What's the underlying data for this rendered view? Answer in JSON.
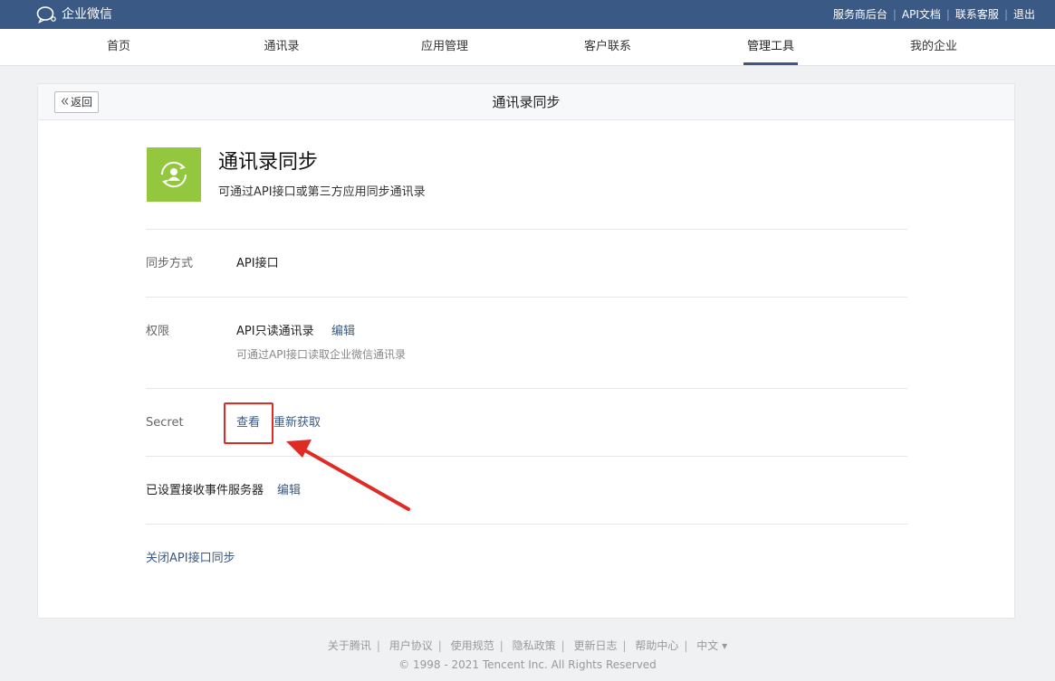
{
  "brand": {
    "name": "企业微信",
    "icon": "wechat-work-logo-icon"
  },
  "top_links": [
    "服务商后台",
    "API文档",
    "联系客服",
    "退出"
  ],
  "nav": {
    "items": [
      "首页",
      "通讯录",
      "应用管理",
      "客户联系",
      "管理工具",
      "我的企业"
    ],
    "active": "管理工具"
  },
  "card": {
    "back_label": "返回",
    "title": "通讯录同步"
  },
  "app": {
    "icon": "contacts-sync-icon",
    "icon_color": "#93c83e",
    "name": "通讯录同步",
    "description": "可通过API接口或第三方应用同步通讯录"
  },
  "rows": {
    "sync_method": {
      "label": "同步方式",
      "value": "API接口"
    },
    "permission": {
      "label": "权限",
      "value": "API只读通讯录",
      "edit": "编辑",
      "hint": "可通过API接口读取企业微信通讯录"
    },
    "secret": {
      "label": "Secret",
      "view": "查看",
      "refresh": "重新获取"
    },
    "event_server": {
      "label": "已设置接收事件服务器",
      "edit": "编辑"
    },
    "disable": {
      "label": "关闭API接口同步"
    }
  },
  "annotation": {
    "color": "#e02b25"
  },
  "footer": {
    "links": [
      "关于腾讯",
      "用户协议",
      "使用规范",
      "隐私政策",
      "更新日志",
      "帮助中心"
    ],
    "language": "中文",
    "copyright": "© 1998 - 2021 Tencent Inc. All Rights Reserved"
  },
  "colors": {
    "topbar": "#3a5a85",
    "link": "#3a5a85"
  }
}
